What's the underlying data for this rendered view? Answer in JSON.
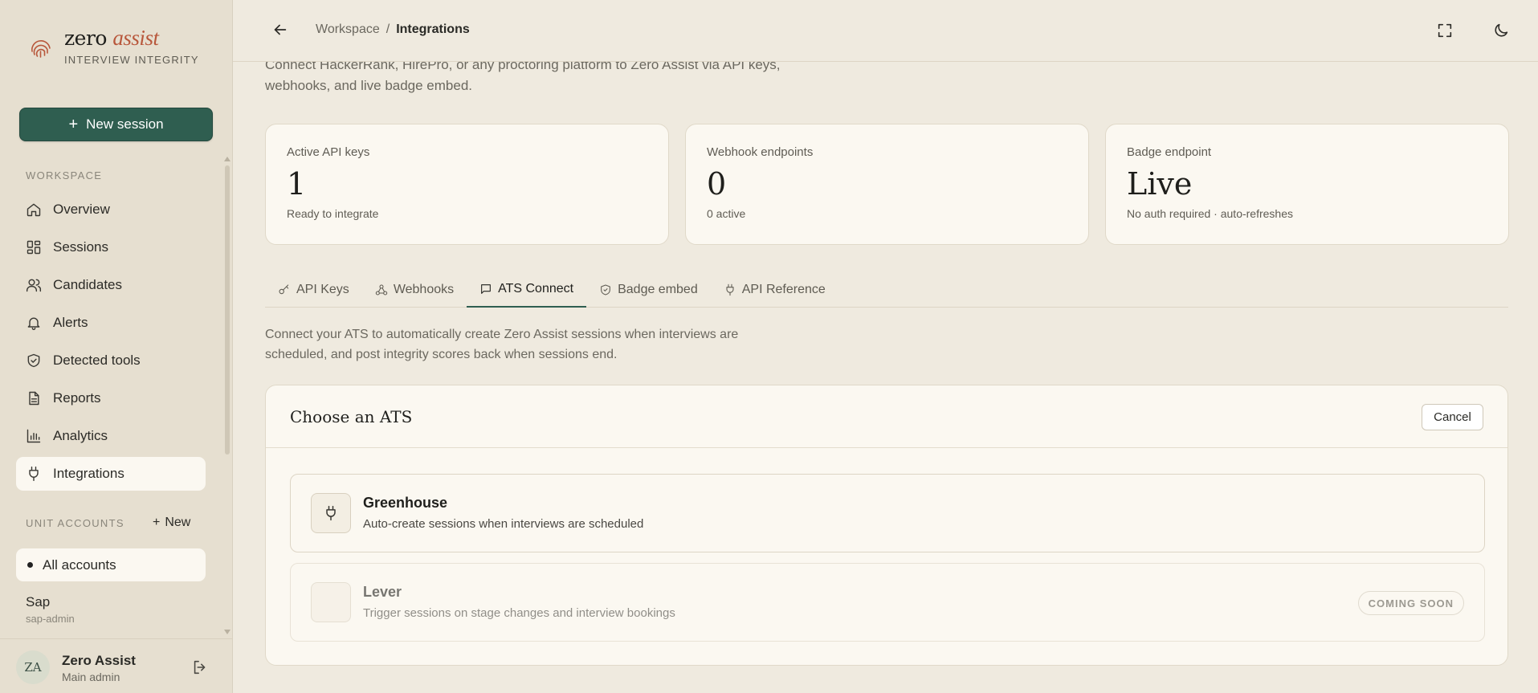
{
  "brand": {
    "name": "zero",
    "accent": "assist",
    "tagline": "INTERVIEW INTEGRITY",
    "logo_icon": "fingerprint-icon"
  },
  "sidebar": {
    "new_session_label": "New session",
    "workspace_label": "WORKSPACE",
    "items": [
      {
        "label": "Overview",
        "icon": "home-icon"
      },
      {
        "label": "Sessions",
        "icon": "grid-icon"
      },
      {
        "label": "Candidates",
        "icon": "users-icon"
      },
      {
        "label": "Alerts",
        "icon": "bell-icon"
      },
      {
        "label": "Detected tools",
        "icon": "shield-check-icon"
      },
      {
        "label": "Reports",
        "icon": "document-icon"
      },
      {
        "label": "Analytics",
        "icon": "bar-chart-icon"
      },
      {
        "label": "Integrations",
        "icon": "plug-icon",
        "active": true
      }
    ],
    "unit_accounts_label": "UNIT ACCOUNTS",
    "unit_new_label": "New",
    "all_accounts_label": "All accounts",
    "account": {
      "name": "Sap",
      "sub": "sap-admin"
    }
  },
  "user": {
    "initials": "ZA",
    "name": "Zero Assist",
    "role": "Main admin"
  },
  "topbar": {
    "crumb_parent": "Workspace",
    "crumb_sep": "/",
    "crumb_current": "Integrations"
  },
  "intro": "Connect HackerRank, HirePro, or any proctoring platform to Zero Assist via API keys, webhooks, and live badge embed.",
  "stats": [
    {
      "label": "Active API keys",
      "value": "1",
      "sub": "Ready to integrate"
    },
    {
      "label": "Webhook endpoints",
      "value": "0",
      "sub": "0 active"
    },
    {
      "label": "Badge endpoint",
      "value": "Live",
      "sub": "No auth required · auto-refreshes"
    }
  ],
  "tabs": [
    {
      "label": "API Keys",
      "icon": "key-icon"
    },
    {
      "label": "Webhooks",
      "icon": "webhook-icon"
    },
    {
      "label": "ATS Connect",
      "icon": "message-icon",
      "active": true
    },
    {
      "label": "Badge embed",
      "icon": "shield-icon"
    },
    {
      "label": "API Reference",
      "icon": "plug-icon"
    }
  ],
  "ats": {
    "description": "Connect your ATS to automatically create Zero Assist sessions when interviews are scheduled, and post integrity scores back when sessions end.",
    "panel_title": "Choose an ATS",
    "cancel_label": "Cancel",
    "options": [
      {
        "name": "Greenhouse",
        "sub": "Auto-create sessions when interviews are scheduled",
        "icon": "plug-icon"
      },
      {
        "name": "Lever",
        "sub": "Trigger sessions on stage changes and interview bookings",
        "badge": "COMING SOON"
      }
    ]
  },
  "colors": {
    "accent": "#2f5e50",
    "brand_accent": "#b8573b",
    "background": "#efeadf",
    "sidebar": "#e6dfd0"
  }
}
